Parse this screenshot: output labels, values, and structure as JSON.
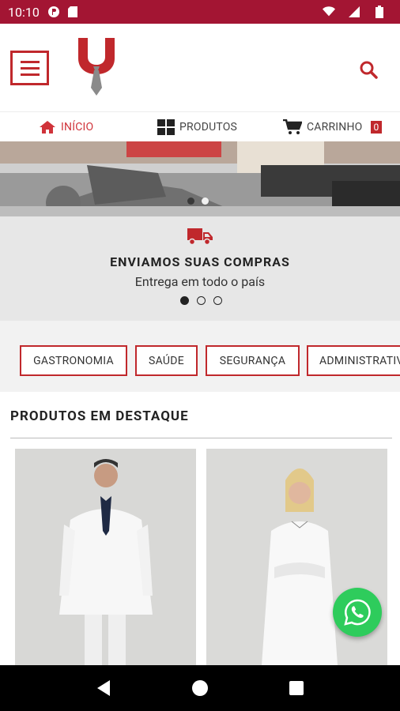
{
  "status_bar": {
    "time": "10:10",
    "icons": [
      "notification-icon",
      "sdcard-icon",
      "wifi-icon",
      "signal-icon",
      "battery-icon"
    ]
  },
  "header": {
    "menu_icon": "hamburger-menu-icon",
    "logo_icon": "uniform-tie-logo",
    "search_icon": "search-icon"
  },
  "nav": {
    "home_label": "INÍCIO",
    "products_label": "PRODUTOS",
    "cart_label": "CARRINHO",
    "cart_count": "0"
  },
  "shipping": {
    "icon": "truck-icon",
    "title": "ENVIAMOS SUAS COMPRAS",
    "subtitle": "Entrega em todo o país"
  },
  "categories": [
    {
      "label": "GASTRONOMIA"
    },
    {
      "label": "SAÚDE"
    },
    {
      "label": "SEGURANÇA"
    },
    {
      "label": "ADMINISTRATIVO"
    }
  ],
  "featured": {
    "title": "PRODUTOS EM DESTAQUE"
  },
  "colors": {
    "brand": "#a31533",
    "accent": "#c0282c",
    "whatsapp": "#2ecc5c"
  }
}
